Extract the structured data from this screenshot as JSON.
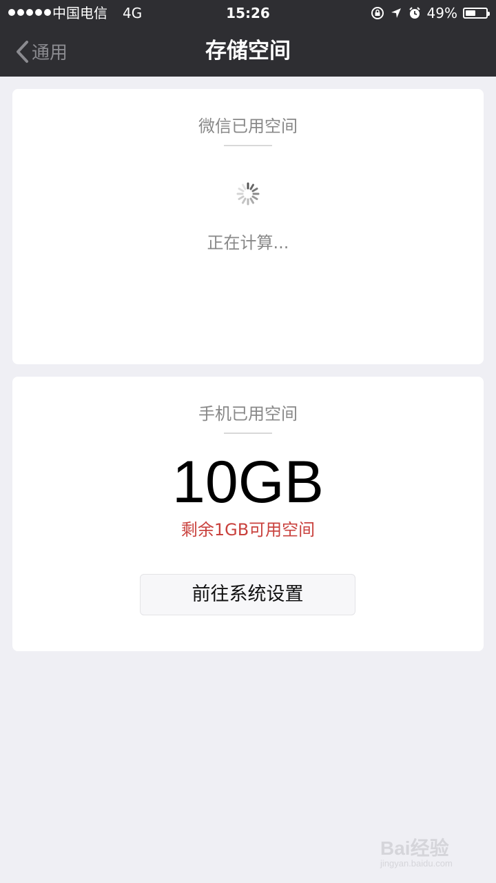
{
  "status_bar": {
    "carrier": "中国电信",
    "network": "4G",
    "time": "15:26",
    "battery_text": "49%",
    "battery_level": 0.49,
    "icons": [
      "orientation-lock-icon",
      "location-arrow-icon",
      "alarm-icon"
    ]
  },
  "nav": {
    "back_label": "通用",
    "title": "存储空间"
  },
  "wechat_card": {
    "title": "微信已用空间",
    "status": "正在计算..."
  },
  "phone_card": {
    "title": "手机已用空间",
    "used": "10GB",
    "remaining": "剩余1GB可用空间",
    "button_label": "前往系统设置"
  },
  "watermark": {
    "main": "Bai经验",
    "sub": "jingyan.baidu.com"
  },
  "colors": {
    "nav_bg": "#2e2e32",
    "page_bg": "#efeff4",
    "remaining_red": "#c9413d"
  }
}
